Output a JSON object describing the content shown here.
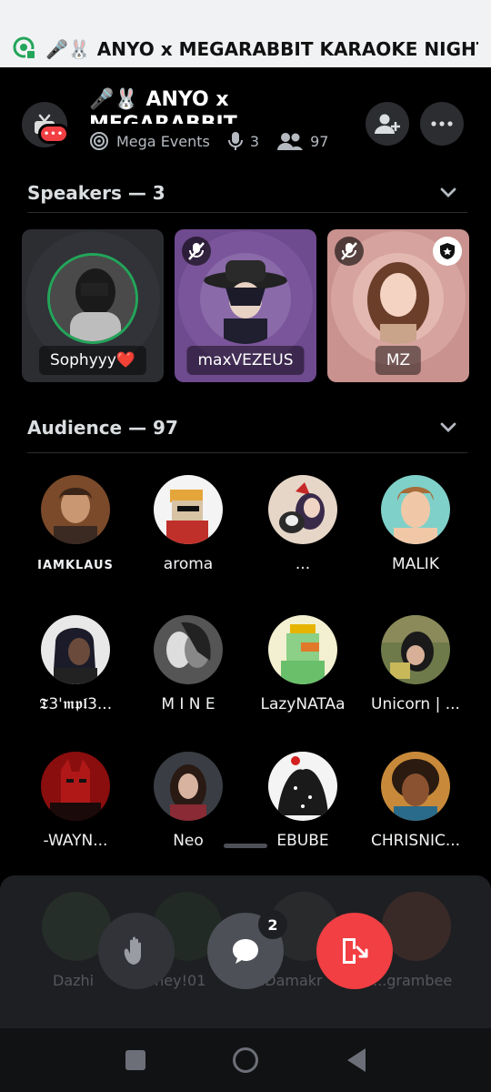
{
  "notification": {
    "title": "🎤🐰 ANYO x MEGARABBIT KARAOKE NIGHT ..."
  },
  "header": {
    "title": "🎤🐰 ANYO x MEGARABBIT KARAOKE",
    "server": "Mega Events",
    "speaker_count": "3",
    "listener_count": "97",
    "tv_badge": "•••"
  },
  "speakers_section": {
    "label": "Speakers — 3",
    "items": [
      {
        "name": "Sophyyy❤️",
        "card_color": "#2b2d31",
        "speaking": true
      },
      {
        "name": "maxVEZEUS",
        "card_color": "#6e4a8e",
        "muted": true
      },
      {
        "name": "MZ",
        "card_color": "#c9928e",
        "muted": true,
        "moderator": true
      }
    ]
  },
  "audience_section": {
    "label": "Audience — 97",
    "items": [
      {
        "name": "IAMKLAUS"
      },
      {
        "name": "aroma"
      },
      {
        "name": "..."
      },
      {
        "name": "MALIK"
      },
      {
        "name": "𝕿3'𝖒𝖕𝖑3..."
      },
      {
        "name": "M I N E"
      },
      {
        "name": "LazyNATAa"
      },
      {
        "name": "Unicorn | ..."
      },
      {
        "name": "-WAYN..."
      },
      {
        "name": "Neo"
      },
      {
        "name": "EBUBE"
      },
      {
        "name": "CHRISNIC..."
      }
    ]
  },
  "behind_sheet": [
    "Dazhi",
    "Shey!01",
    "...Damakr",
    "...grambee"
  ],
  "controls": {
    "chat_badge": "2"
  },
  "colors": {
    "accent_red": "#f23f43",
    "speaking_green": "#23a55a",
    "bg": "#000000"
  }
}
